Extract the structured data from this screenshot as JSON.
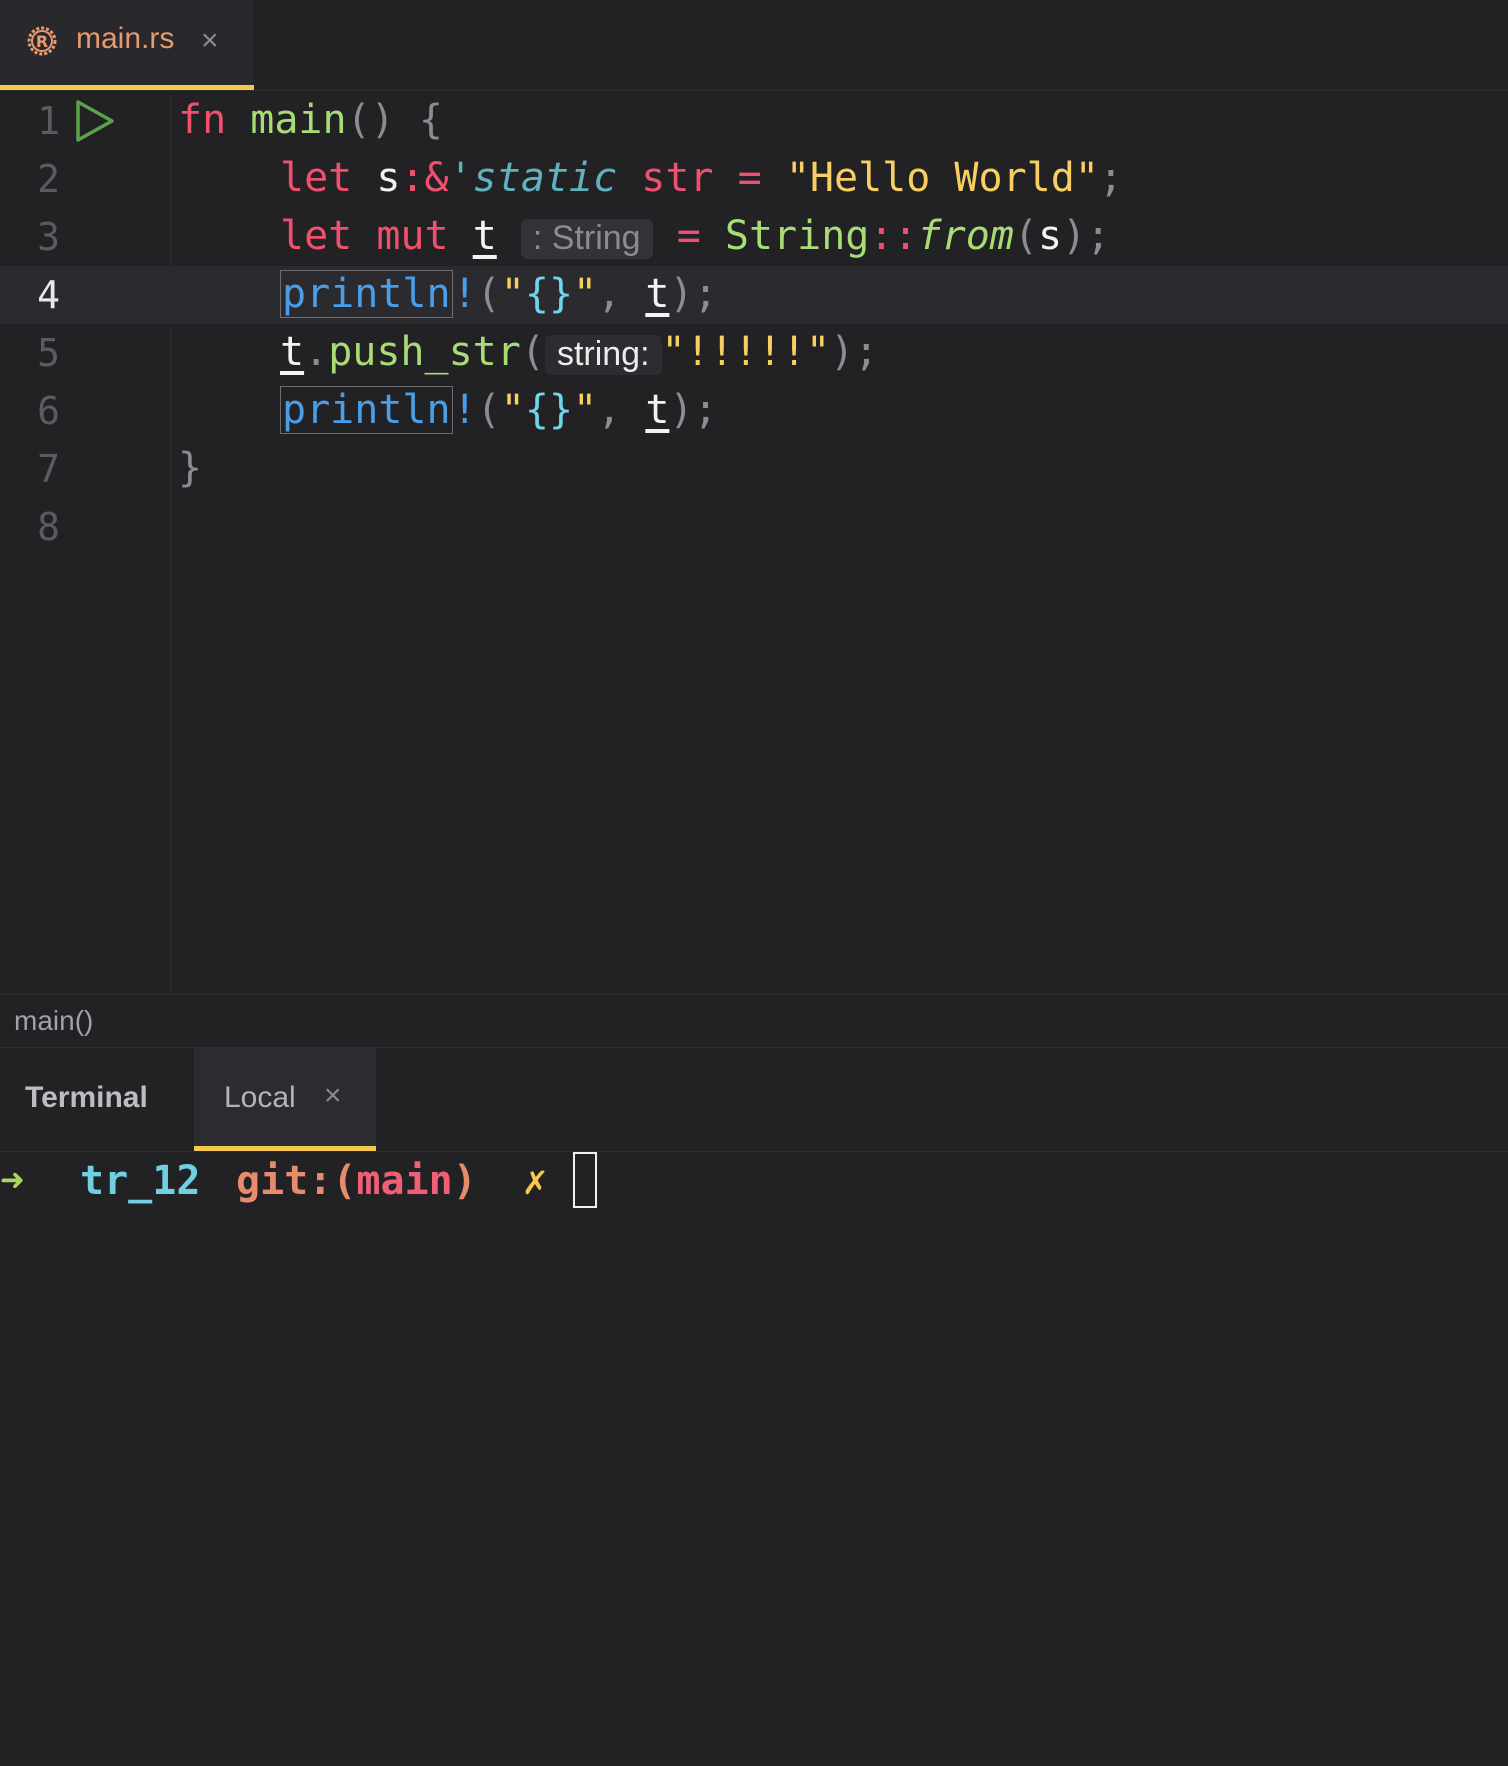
{
  "tab": {
    "filename": "main.rs",
    "close": "×"
  },
  "editor": {
    "line_numbers": [
      "1",
      "2",
      "3",
      "4",
      "5",
      "6",
      "7",
      "8"
    ],
    "active_line": "4",
    "l1": {
      "kw": "fn",
      "name": "main",
      "parens": "()",
      "brace": "{"
    },
    "l2": {
      "kw": "let",
      "var": "s",
      "colon": ":",
      "amp": "&",
      "lifetime": "'static",
      "type": "str",
      "eq": "=",
      "str": "\"Hello World\"",
      "semi": ";"
    },
    "l3": {
      "kw1": "let",
      "kw2": "mut",
      "var": "t",
      "hint": ": String",
      "eq": "=",
      "type": "String",
      "path": "::",
      "method": "from",
      "open": "(",
      "arg": "s",
      "close": ");"
    },
    "l4": {
      "macro": "println",
      "bang": "!",
      "open": "(",
      "q1": "\"",
      "fmt": "{}",
      "q2": "\"",
      "comma": ",",
      "arg": "t",
      "close": ");"
    },
    "l5": {
      "var": "t",
      "dot": ".",
      "method": "push_str",
      "open": "(",
      "hint": "string:",
      "str": "\"!!!!!\"",
      "close": ");"
    },
    "l6": {
      "macro": "println",
      "bang": "!",
      "open": "(",
      "q1": "\"",
      "fmt": "{}",
      "q2": "\"",
      "comma": ",",
      "arg": "t",
      "close": ");"
    },
    "l7": {
      "brace": "}"
    }
  },
  "breadcrumb": "main()",
  "terminal": {
    "title": "Terminal",
    "tab_label": "Local",
    "tab_close": "×",
    "prompt_arrow": "➜",
    "dir": "tr_12",
    "git_prefix": "git:(",
    "branch": "main",
    "git_suffix": ")",
    "dirty": "✗"
  },
  "colors": {
    "accent": "#f2c94c",
    "background": "#222124",
    "keyword": "#f0506e",
    "string": "#f7d061",
    "function": "#a8dc76",
    "macro": "#4a9ee8"
  }
}
